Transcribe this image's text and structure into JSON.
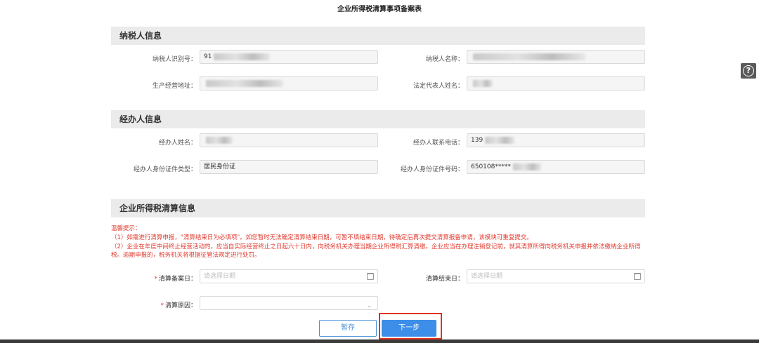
{
  "page_title": "企业所得税清算事项备案表",
  "taxpayer_section": {
    "header": "纳税人信息",
    "id_label": "纳税人识别号：",
    "id_value": "91",
    "name_label": "纳税人名称：",
    "address_label": "生产经营地址：",
    "legal_rep_label": "法定代表人姓名："
  },
  "agent_section": {
    "header": "经办人信息",
    "name_label": "经办人姓名：",
    "phone_label": "经办人联系电话：",
    "phone_value": "139",
    "id_type_label": "经办人身份证件类型：",
    "id_type_value": "居民身份证",
    "id_number_label": "经办人身份证件号码：",
    "id_number_value": "650108*****"
  },
  "liquidation_section": {
    "header": "企业所得税清算信息",
    "notice_title": "温馨提示：",
    "notice_1": "（1）如需进行清算申报，\"清算结束日为必填项\"。如您暂时无法确定清算结束日期，可暂不填结束日期，待确定后再次提交清算报备申请，该模块可重复提交。",
    "notice_2": "（2）企业在年度中间终止经营活动的，应当自实际经营终止之日起六十日内，向税务机关办理当期企业所得税汇算清缴。企业应当在办理注销登记前，就其清算所得向税务机关申报并依法缴纳企业所得税。逾期申报的，税务机关将根据征管法规定进行处罚。",
    "filing_date_label": "清算备案日：",
    "filing_date_placeholder": "请选择日期",
    "end_date_label": "清算结束日：",
    "end_date_placeholder": "请选择日期",
    "reason_label": "清算原因："
  },
  "buttons": {
    "save": "暂存",
    "next": "下一步"
  },
  "help_icon": "question-circle-icon",
  "colors": {
    "required": "#e03a2f",
    "primary": "#3c8ee8",
    "highlight": "#e0331d"
  }
}
